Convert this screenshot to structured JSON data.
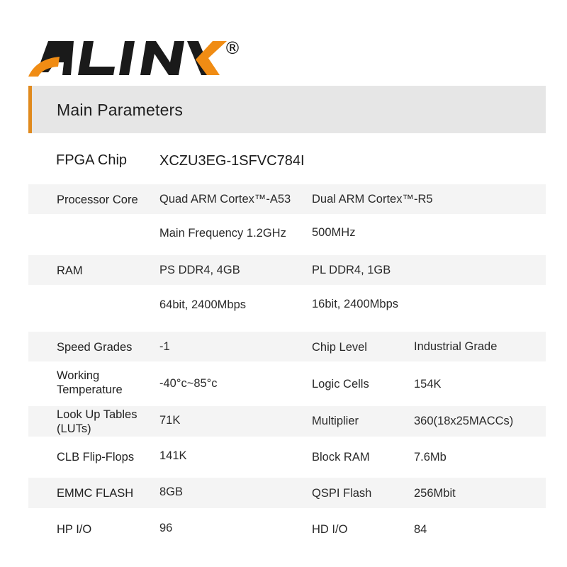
{
  "brand": {
    "logo_text": "ALINX",
    "registered_mark": "®",
    "colors": {
      "black": "#1a1a1a",
      "orange": "#f08c14"
    }
  },
  "section": {
    "title": "Main Parameters",
    "accent_color": "#e08a1e"
  },
  "fpga": {
    "label": "FPGA Chip",
    "value": "XCZU3EG-1SFVC784I"
  },
  "rows": [
    {
      "label": "Processor Core",
      "v1": "Quad ARM Cortex™-A53",
      "v2": "Dual ARM Cortex™-R5",
      "band": true
    },
    {
      "label": "",
      "v1": "Main Frequency 1.2GHz",
      "v2": "500MHz",
      "band": false
    },
    {
      "label": "RAM",
      "v1": "PS DDR4, 4GB",
      "v2": "PL DDR4, 1GB",
      "band": true
    },
    {
      "label": "",
      "v1": "64bit, 2400Mbps",
      "v2": "16bit, 2400Mbps",
      "band": false
    }
  ],
  "pairs": [
    {
      "label": "Speed Grades",
      "value": "-1",
      "label2": "Chip Level",
      "value2": "Industrial Grade",
      "band": true
    },
    {
      "label": "Working Temperature",
      "value": "-40°c~85°c",
      "label2": "Logic Cells",
      "value2": "154K",
      "band": false
    },
    {
      "label": "Look Up Tables (LUTs)",
      "value": "71K",
      "label2": "Multiplier",
      "value2": "360(18x25MACCs)",
      "band": true
    },
    {
      "label": "CLB Flip-Flops",
      "value": "141K",
      "label2": "Block RAM",
      "value2": "7.6Mb",
      "band": false
    },
    {
      "label": "EMMC FLASH",
      "value": "8GB",
      "label2": "QSPI Flash",
      "value2": "256Mbit",
      "band": true
    },
    {
      "label": "HP I/O",
      "value": "96",
      "label2": "HD I/O",
      "value2": "84",
      "band": false
    }
  ]
}
